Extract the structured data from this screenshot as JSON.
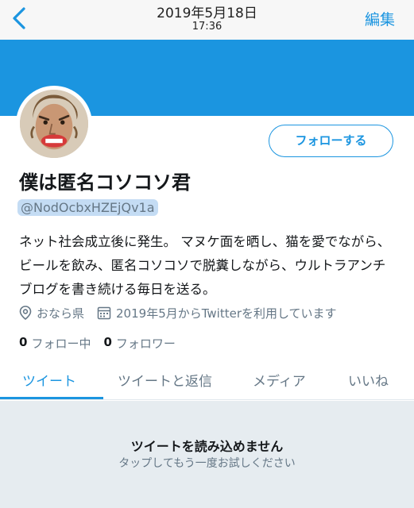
{
  "nav": {
    "title": "2019年5月18日",
    "time": "17:36",
    "edit_label": "編集"
  },
  "profile": {
    "follow_label": "フォローする",
    "name": "僕は匿名コソコソ君",
    "handle": "@NodOcbxHZEjQv1a",
    "bio": "ネット社会成立後に発生。 マヌケ面を晒し、猫を愛でながら、ビールを飲み、匿名コソコソで脱糞しながら、ウルトラアンチブログを書き続ける毎日を送る。",
    "location": "おなら県",
    "joined": "2019年5月からTwitterを利用しています",
    "following_count": "0",
    "following_label": "フォロー中",
    "followers_count": "0",
    "followers_label": "フォロワー"
  },
  "tabs": [
    {
      "label": "ツイート"
    },
    {
      "label": "ツイートと返信"
    },
    {
      "label": "メディア"
    },
    {
      "label": "いいね"
    }
  ],
  "feed": {
    "error_title": "ツイートを読み込めません",
    "error_sub": "タップしてもう一度お試しください"
  },
  "colors": {
    "accent": "#1b95e0",
    "banner": "#1b95e0",
    "muted": "#657786",
    "feed_bg": "#e6ecf0"
  }
}
